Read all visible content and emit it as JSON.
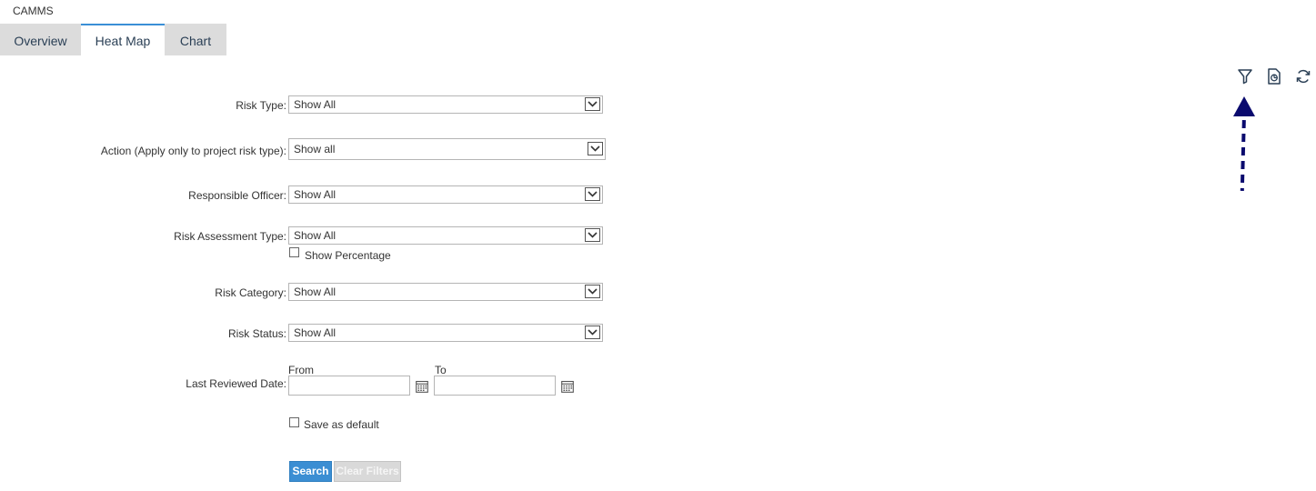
{
  "app": {
    "title": "CAMMS"
  },
  "tabs": [
    {
      "label": "Overview"
    },
    {
      "label": "Heat Map"
    },
    {
      "label": "Chart"
    }
  ],
  "toolbar": {
    "icons": [
      "filter-icon",
      "report-icon",
      "refresh-icon"
    ],
    "annotation_color": "#0a0a6e"
  },
  "filters": {
    "risk_type": {
      "label": "Risk Type:",
      "value": "Show All"
    },
    "action": {
      "label": "Action (Apply only to project risk type):",
      "value": "Show all"
    },
    "responsible_officer": {
      "label": "Responsible Officer:",
      "value": "Show All"
    },
    "risk_assessment_type": {
      "label": "Risk Assessment Type:",
      "value": "Show All"
    },
    "show_percentage": {
      "label": "Show Percentage",
      "checked": false
    },
    "risk_category": {
      "label": "Risk Category:",
      "value": "Show All"
    },
    "risk_status": {
      "label": "Risk Status:",
      "value": "Show All"
    },
    "last_reviewed_date": {
      "label": "Last Reviewed Date:",
      "from_label": "From",
      "to_label": "To",
      "from_value": "",
      "to_value": ""
    },
    "save_as_default": {
      "label": "Save as default",
      "checked": false
    }
  },
  "buttons": {
    "search": "Search",
    "clear_filters": "Clear Filters"
  },
  "colors": {
    "accent": "#3b8ed3",
    "tab_inactive": "#dcdcdc",
    "tab_text": "#2a3f55"
  }
}
